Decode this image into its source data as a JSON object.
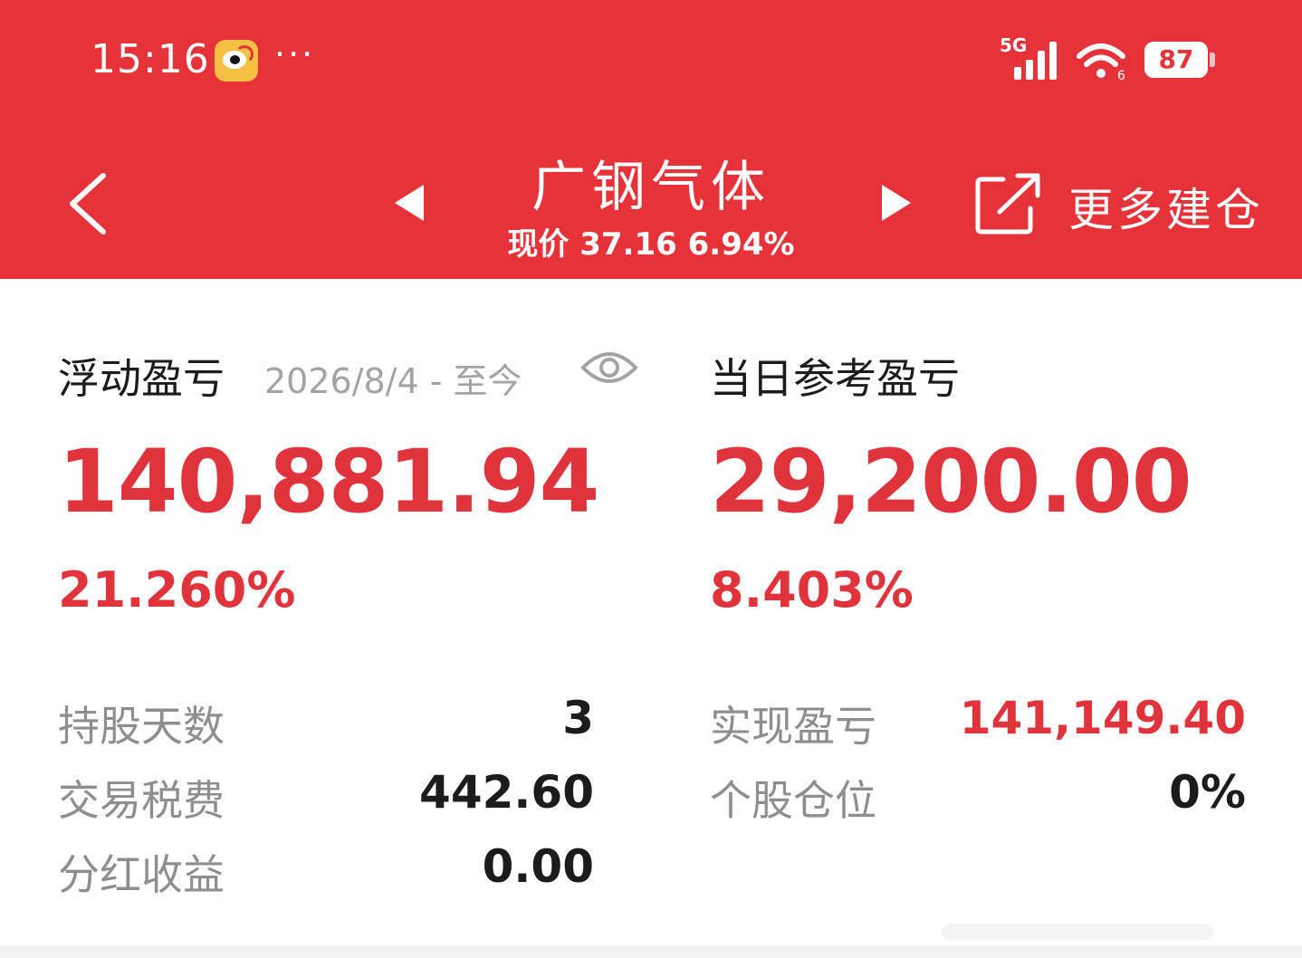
{
  "status_bar": {
    "time": "15:16",
    "overflow": "···",
    "network": "5G",
    "battery": "87",
    "icons": [
      "weibo-icon",
      "signal-icon",
      "wifi-icon",
      "battery-icon"
    ]
  },
  "header": {
    "title": "广钢气体",
    "price_line": "现价 37.16 6.94%",
    "more_label": "更多建仓",
    "icons": [
      "back-chevron-icon",
      "prev-triangle-icon",
      "next-triangle-icon",
      "share-external-icon"
    ]
  },
  "floating": {
    "label": "浮动盈亏",
    "date_range": "2026/8/4 - 至今",
    "amount": "140,881.94",
    "percent": "21.260%"
  },
  "daily": {
    "label": "当日参考盈亏",
    "amount": "29,200.00",
    "percent": "8.403%"
  },
  "details": {
    "left": [
      {
        "label": "持股天数",
        "value": "3"
      },
      {
        "label": "交易税费",
        "value": "442.60"
      },
      {
        "label": "分红收益",
        "value": "0.00"
      }
    ],
    "right": [
      {
        "label": "实现盈亏",
        "value": "141,149.40"
      },
      {
        "label": "个股仓位",
        "value": "0%"
      }
    ]
  },
  "colors": {
    "header_bg": "#e8323a",
    "gain_red": "#e1333b",
    "muted_gray": "#8e8e8e"
  }
}
